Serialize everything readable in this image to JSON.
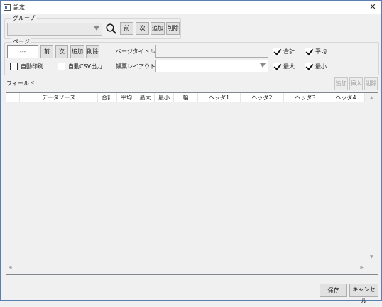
{
  "window": {
    "title": "設定"
  },
  "group": {
    "legend": "グループ",
    "select_value": "",
    "buttons": {
      "prev": "前",
      "next": "次",
      "add": "追加",
      "delete": "削除"
    }
  },
  "page": {
    "legend": "ページ",
    "number_value": "---",
    "buttons": {
      "prev": "前",
      "next": "次",
      "add": "追加",
      "delete": "削除"
    },
    "title_label": "ページタイトル：",
    "title_value": "",
    "layout_label": "帳票レイアウト：",
    "layout_value": "",
    "auto_print_label": "自動印刷",
    "auto_print_checked": false,
    "auto_csv_label": "自動CSV出力",
    "auto_csv_checked": false,
    "sum_label": "合計",
    "sum_checked": true,
    "avg_label": "平均",
    "avg_checked": true,
    "max_label": "最大",
    "max_checked": true,
    "min_label": "最小",
    "min_checked": true
  },
  "fields": {
    "label": "フィールド",
    "buttons": {
      "add": "追加",
      "insert": "挿入",
      "delete": "削除"
    },
    "columns": [
      "",
      "データソース",
      "合計",
      "平均",
      "最大",
      "最小",
      "幅",
      "ヘッダ1",
      "ヘッダ2",
      "ヘッダ3",
      "ヘッダ4"
    ]
  },
  "footer": {
    "save": "保存",
    "cancel": "キャンセル"
  }
}
